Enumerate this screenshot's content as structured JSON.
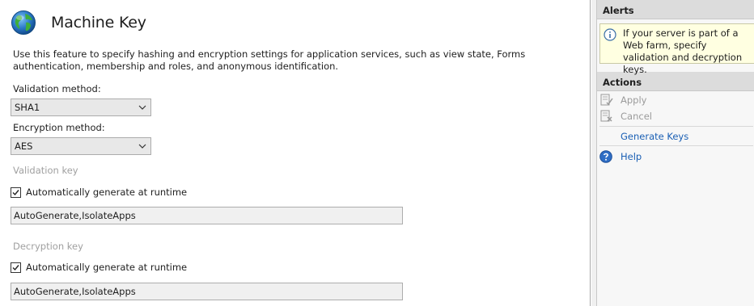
{
  "page": {
    "title": "Machine Key",
    "description": "Use this feature to specify hashing and encryption settings for application services, such as view state, Forms authentication, membership and roles, and anonymous identification."
  },
  "validation_method": {
    "label": "Validation method:",
    "value": "SHA1"
  },
  "encryption_method": {
    "label": "Encryption method:",
    "value": "AES"
  },
  "validation_key": {
    "label": "Validation key",
    "auto_generate_label": "Automatically generate at runtime",
    "auto_generate_checked": true,
    "value": "AutoGenerate,IsolateApps"
  },
  "decryption_key": {
    "label": "Decryption key",
    "auto_generate_label": "Automatically generate at runtime",
    "auto_generate_checked": true,
    "value": "AutoGenerate,IsolateApps"
  },
  "alerts": {
    "header": "Alerts",
    "message": "If your server is part of a Web farm, specify validation and decryption keys."
  },
  "actions": {
    "header": "Actions",
    "apply": "Apply",
    "cancel": "Cancel",
    "generate_keys": "Generate Keys",
    "help": "Help"
  },
  "colors": {
    "link": "#1a5fb4",
    "disabled_text": "#9b9b9b",
    "alert_background": "#ffffe1",
    "pane_header": "#dcdcdc"
  }
}
